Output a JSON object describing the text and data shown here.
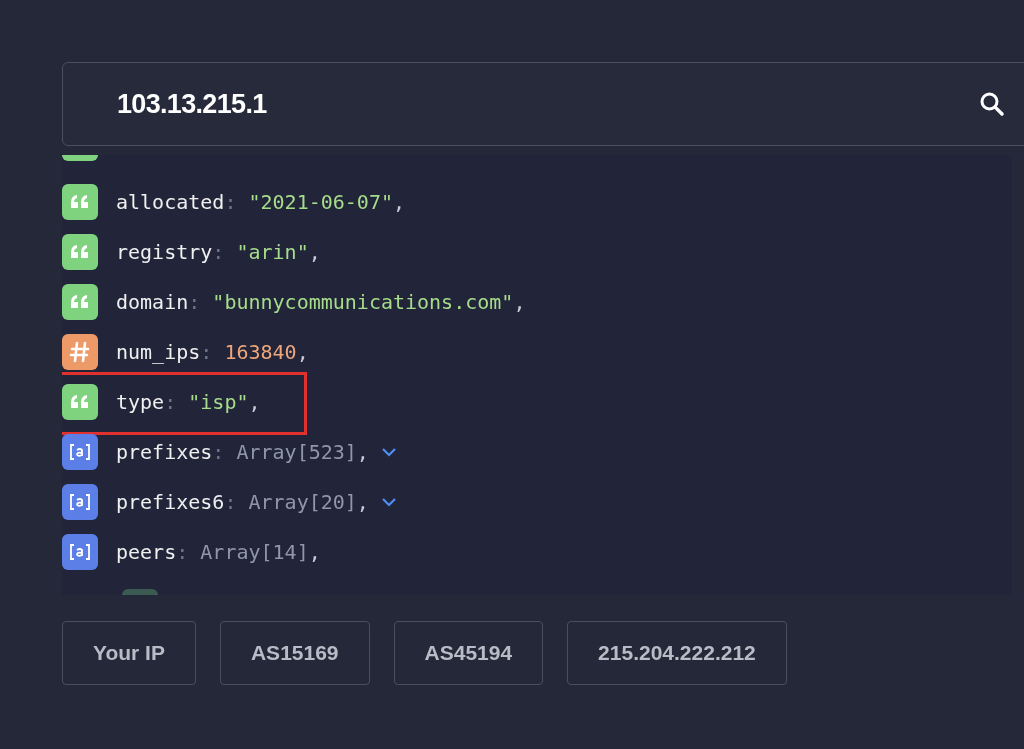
{
  "search": {
    "value": "103.13.215.1"
  },
  "fields": [
    {
      "kind": "string",
      "key": "allocated",
      "separator": ":",
      "value": "\"2021-06-07\"",
      "trailing": ",",
      "expandable": false,
      "highlighted": false
    },
    {
      "kind": "string",
      "key": "registry",
      "separator": ":",
      "value": "\"arin\"",
      "trailing": ",",
      "expandable": false,
      "highlighted": false
    },
    {
      "kind": "string",
      "key": "domain",
      "separator": ":",
      "value": "\"bunnycommunications.com\"",
      "trailing": ",",
      "expandable": false,
      "highlighted": false
    },
    {
      "kind": "number",
      "key": "num_ips",
      "separator": ":",
      "value": "163840",
      "trailing": ",",
      "expandable": false,
      "highlighted": false
    },
    {
      "kind": "string",
      "key": "type",
      "separator": ":",
      "value": "\"isp\"",
      "trailing": ",",
      "expandable": false,
      "highlighted": true
    },
    {
      "kind": "array",
      "key": "prefixes",
      "separator": ":",
      "value": "Array[523]",
      "trailing": ",",
      "expandable": true,
      "highlighted": false
    },
    {
      "kind": "array",
      "key": "prefixes6",
      "separator": ":",
      "value": "Array[20]",
      "trailing": ",",
      "expandable": true,
      "highlighted": false
    },
    {
      "kind": "array",
      "key": "peers",
      "separator": ":",
      "value": "Array[14]",
      "trailing": ",",
      "expandable": false,
      "highlighted": false
    }
  ],
  "quick_links": [
    "Your IP",
    "AS15169",
    "AS45194",
    "215.204.222.212"
  ]
}
